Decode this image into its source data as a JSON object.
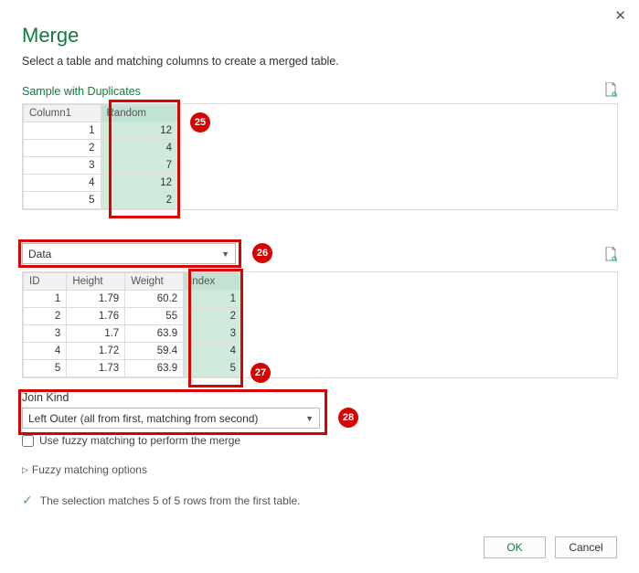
{
  "title": "Merge",
  "subtitle": "Select a table and matching columns to create a merged table.",
  "source1_label": "Sample with Duplicates",
  "table1": {
    "headers": {
      "c1": "Column1",
      "c2": "Random"
    },
    "rows": [
      {
        "c1": "1",
        "c2": "12"
      },
      {
        "c1": "2",
        "c2": "4"
      },
      {
        "c1": "3",
        "c2": "7"
      },
      {
        "c1": "4",
        "c2": "12"
      },
      {
        "c1": "5",
        "c2": "2"
      }
    ]
  },
  "source2_selected": "Data",
  "table2": {
    "headers": {
      "h1": "ID",
      "h2": "Height",
      "h3": "Weight",
      "h4": "Index"
    },
    "rows": [
      {
        "c1": "1",
        "c2": "1.79",
        "c3": "60.2",
        "c4": "1"
      },
      {
        "c1": "2",
        "c2": "1.76",
        "c3": "55",
        "c4": "2"
      },
      {
        "c1": "3",
        "c2": "1.7",
        "c3": "63.9",
        "c4": "3"
      },
      {
        "c1": "4",
        "c2": "1.72",
        "c3": "59.4",
        "c4": "4"
      },
      {
        "c1": "5",
        "c2": "1.73",
        "c3": "63.9",
        "c4": "5"
      }
    ]
  },
  "join_kind_label": "Join Kind",
  "join_kind_value": "Left Outer (all from first, matching from second)",
  "fuzzy_checkbox_label": "Use fuzzy matching to perform the merge",
  "fuzzy_options_label": "Fuzzy matching options",
  "match_status": "The selection matches 5 of 5 rows from the first table.",
  "buttons": {
    "ok": "OK",
    "cancel": "Cancel"
  },
  "callouts": {
    "c25": "25",
    "c26": "26",
    "c27": "27",
    "c28": "28"
  }
}
